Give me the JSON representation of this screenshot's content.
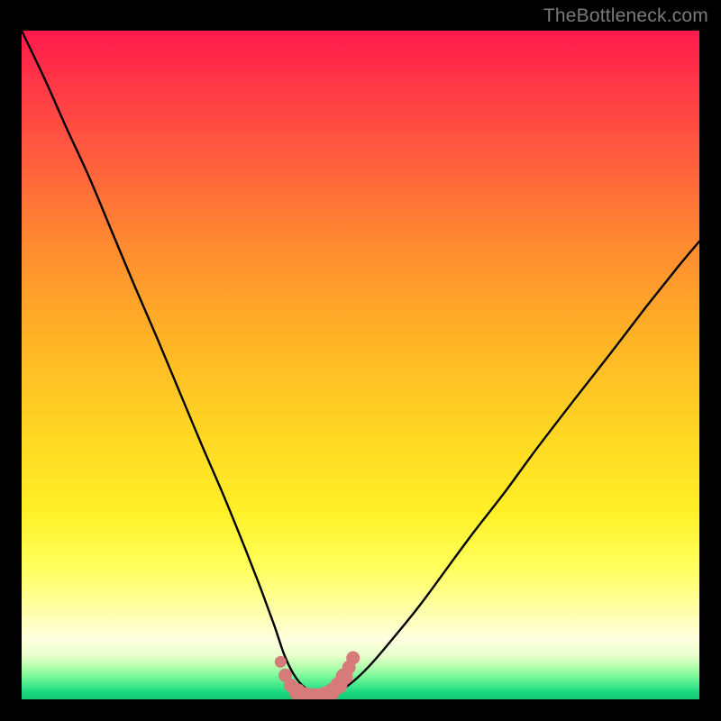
{
  "watermark": {
    "text": "TheBottleneck.com"
  },
  "chart_data": {
    "type": "line",
    "title": "",
    "xlabel": "",
    "ylabel": "",
    "xlim": [
      0,
      100
    ],
    "ylim": [
      0,
      100
    ],
    "grid": false,
    "legend": false,
    "annotations": [],
    "background_gradient": {
      "top_color": "#ff1a4d",
      "bottom_color": "#14c778",
      "meaning": "red = high bottleneck, green = low bottleneck"
    },
    "series": [
      {
        "name": "bottleneck-curve",
        "color": "#000000",
        "x": [
          0.0,
          3.3,
          6.6,
          10.0,
          13.3,
          16.6,
          20.0,
          23.3,
          26.6,
          30.0,
          33.0,
          35.3,
          37.3,
          38.7,
          40.0,
          41.3,
          42.7,
          44.0,
          45.3,
          46.8,
          48.7,
          51.3,
          54.7,
          58.7,
          62.7,
          66.7,
          71.3,
          76.0,
          81.3,
          86.7,
          92.0,
          96.7,
          100.0
        ],
        "y": [
          100.0,
          93.0,
          85.5,
          78.0,
          70.0,
          62.0,
          54.0,
          46.0,
          38.0,
          30.0,
          22.5,
          16.5,
          11.0,
          6.8,
          4.0,
          2.2,
          1.2,
          0.7,
          0.7,
          1.2,
          2.5,
          5.0,
          9.0,
          14.0,
          19.5,
          25.0,
          31.0,
          37.5,
          44.5,
          51.5,
          58.5,
          64.5,
          68.5
        ]
      },
      {
        "name": "highlight-bottom",
        "color": "#d77a7a",
        "style": "thick-dotted",
        "x": [
          38.2,
          38.9,
          39.7,
          40.7,
          41.9,
          43.2,
          44.5,
          45.7,
          46.8,
          47.6,
          48.3,
          48.9
        ],
        "y": [
          5.6,
          3.6,
          2.1,
          1.1,
          0.55,
          0.4,
          0.55,
          1.1,
          2.1,
          3.4,
          4.8,
          6.2
        ]
      }
    ]
  }
}
